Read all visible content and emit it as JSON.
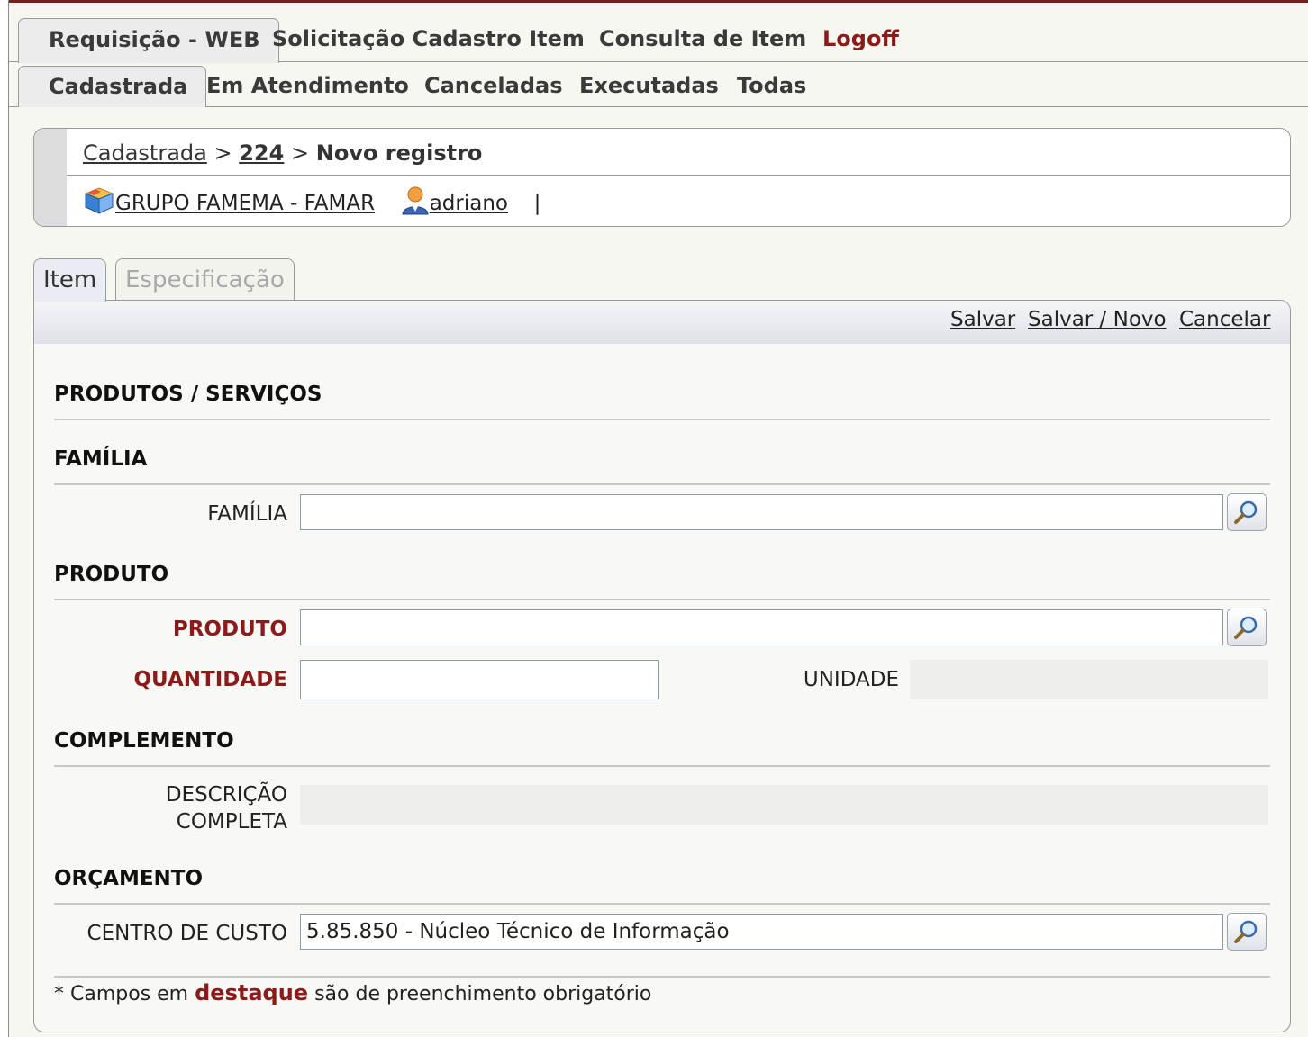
{
  "topnav": {
    "items": [
      {
        "label": "Requisição - WEB",
        "active": true
      },
      {
        "label": "Solicitação Cadastro Item",
        "active": false
      },
      {
        "label": "Consulta de Item",
        "active": false
      },
      {
        "label": "Logoff",
        "active": false
      }
    ]
  },
  "subnav": {
    "items": [
      {
        "label": "Cadastrada",
        "active": true
      },
      {
        "label": "Em Atendimento",
        "active": false
      },
      {
        "label": "Canceladas",
        "active": false
      },
      {
        "label": "Executadas",
        "active": false
      },
      {
        "label": "Todas",
        "active": false
      }
    ]
  },
  "breadcrumb": {
    "root": "Cadastrada",
    "separator": ">",
    "number": "224",
    "current": "Novo registro",
    "company": "GRUPO FAMEMA - FAMAR",
    "user": "adriano",
    "pipe": "|"
  },
  "form_tabs": {
    "item": "Item",
    "spec": "Especificação"
  },
  "toolbar": {
    "save": "Salvar",
    "save_new": "Salvar / Novo",
    "cancel": "Cancelar"
  },
  "sections": {
    "produtos": "PRODUTOS / SERVIÇOS",
    "familia": "FAMÍLIA",
    "produto": "PRODUTO",
    "complemento": "COMPLEMENTO",
    "orcamento": "ORÇAMENTO"
  },
  "fields": {
    "familia_label": "FAMÍLIA",
    "familia_value": "",
    "produto_label": "PRODUTO",
    "produto_value": "",
    "quantidade_label": "QUANTIDADE",
    "quantidade_value": "",
    "unidade_label": "UNIDADE",
    "unidade_value": "",
    "descricao_label_1": "DESCRIÇÃO",
    "descricao_label_2": "COMPLETA",
    "descricao_value": "",
    "centro_label": "CENTRO DE CUSTO",
    "centro_value": "5.85.850 - Núcleo Técnico de Informação"
  },
  "footnote": {
    "prefix": "* Campos em",
    "highlight": "destaque",
    "suffix": "são de preenchimento obrigatório"
  },
  "colors": {
    "required_red": "#8b1a1a",
    "background": "#f7f7f1",
    "field_border": "#8a9bb0"
  },
  "icons": [
    "company-box-icon",
    "user-icon",
    "magnifier-icon"
  ]
}
